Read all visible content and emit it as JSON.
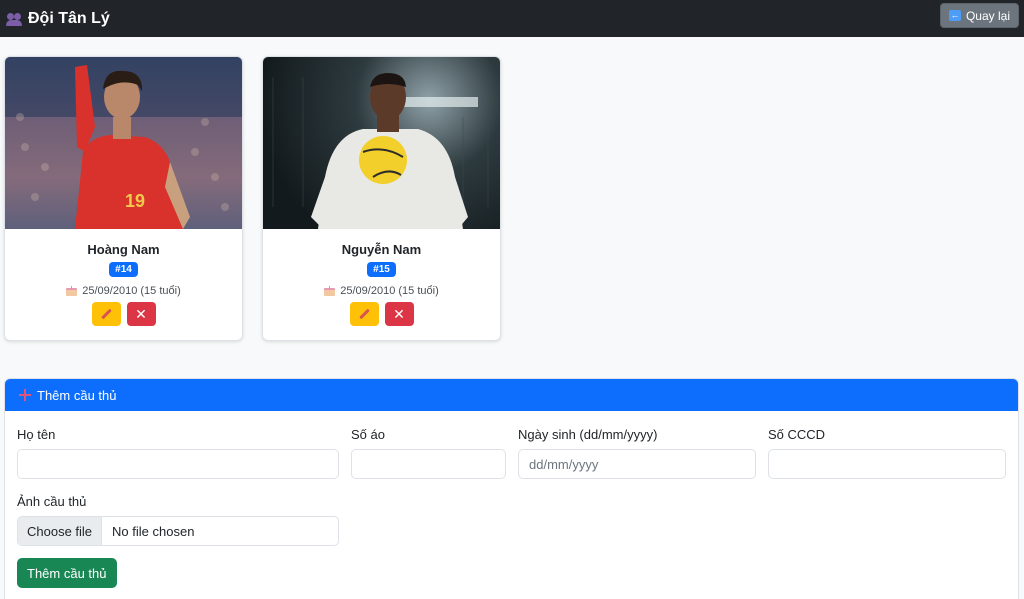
{
  "header": {
    "icon": "people-icon",
    "title": "Đội Tân Lý",
    "back_label": "Quay lại"
  },
  "players": [
    {
      "name": "Hoàng Nam",
      "number": "#14",
      "dob": "25/09/2010 (15 tuổi)"
    },
    {
      "name": "Nguyễn Nam",
      "number": "#15",
      "dob": "25/09/2010 (15 tuổi)"
    }
  ],
  "form": {
    "title": "Thêm cầu thủ",
    "name_label": "Họ tên",
    "number_label": "Số áo",
    "dob_label": "Ngày sinh (dd/mm/yyyy)",
    "dob_placeholder": "dd/mm/yyyy",
    "id_label": "Số CCCD",
    "photo_label": "Ảnh cầu thủ",
    "file_button": "Choose file",
    "file_status": "No file chosen",
    "submit_label": "Thêm cầu thủ"
  },
  "colors": {
    "topbar": "#212529",
    "primary": "#0d6efd",
    "warning": "#ffc107",
    "danger": "#dc3545",
    "success": "#198754"
  }
}
